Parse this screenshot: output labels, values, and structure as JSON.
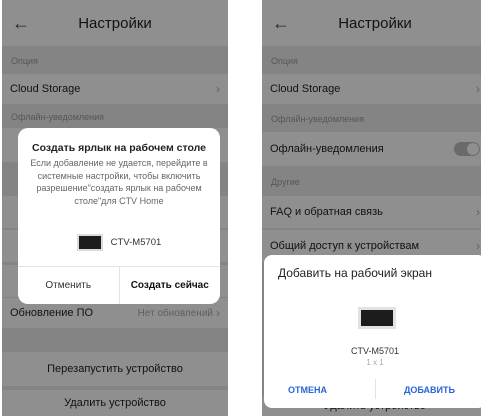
{
  "left": {
    "header_title": "Настройки",
    "section_option": "Опция",
    "cloud_storage": "Cloud Storage",
    "section_offline": "Офлайн-уведомления",
    "firmware_label": "Обновление ПО",
    "firmware_value": "Нет обновлений",
    "restart": "Перезапустить устройство",
    "delete": "Удалить устройство",
    "dialog": {
      "title": "Создать ярлык на рабочем столе",
      "message": "Если добавление не удается, перейдите в системные настройки, чтобы включить разрешение\"создать ярлык на рабочем столе\"для CTV Home",
      "device_name": "CTV-M5701",
      "cancel": "Отменить",
      "confirm": "Создать сейчас"
    }
  },
  "right": {
    "header_title": "Настройки",
    "section_option": "Опция",
    "cloud_storage": "Cloud Storage",
    "section_offline": "Офлайн-уведомления",
    "offline_row": "Офлайн-уведомления",
    "offline_toggle_on": false,
    "section_other": "Другие",
    "faq": "FAQ и обратная связь",
    "sharing": "Общий доступ к устройствам",
    "delete_partial": "Удалить устройство",
    "sheet": {
      "title": "Добавить на рабочий экран",
      "device_name": "CTV-M5701",
      "size": "1 x 1",
      "cancel": "ОТМЕНА",
      "add": "ДОБАВИТЬ"
    }
  },
  "colors": {
    "accent_blue": "#2a65d6",
    "overlay": "rgba(0,0,0,0.44)",
    "background": "#ececec"
  }
}
